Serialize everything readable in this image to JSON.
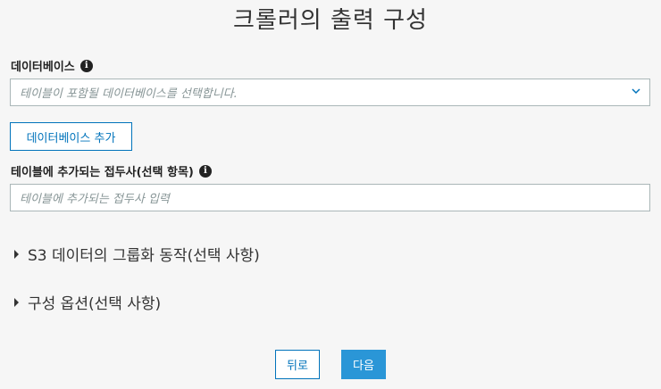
{
  "page": {
    "title": "크롤러의 출력 구성"
  },
  "database": {
    "label": "데이터베이스",
    "placeholder": "테이블이 포함될 데이터베이스를 선택합니다.",
    "add_button": "데이터베이스 추가"
  },
  "prefix": {
    "label": "테이블에 추가되는 접두사(선택 항목)",
    "placeholder": "테이블에 추가되는 접두사 입력"
  },
  "sections": [
    {
      "label": "S3 데이터의 그룹화 동작(선택 사항)"
    },
    {
      "label": "구성 옵션(선택 사항)"
    }
  ],
  "footer": {
    "back": "뒤로",
    "next": "다음"
  },
  "colors": {
    "accent": "#0073bb",
    "primary_button": "#2a96d7",
    "background": "#f6f6f6"
  }
}
